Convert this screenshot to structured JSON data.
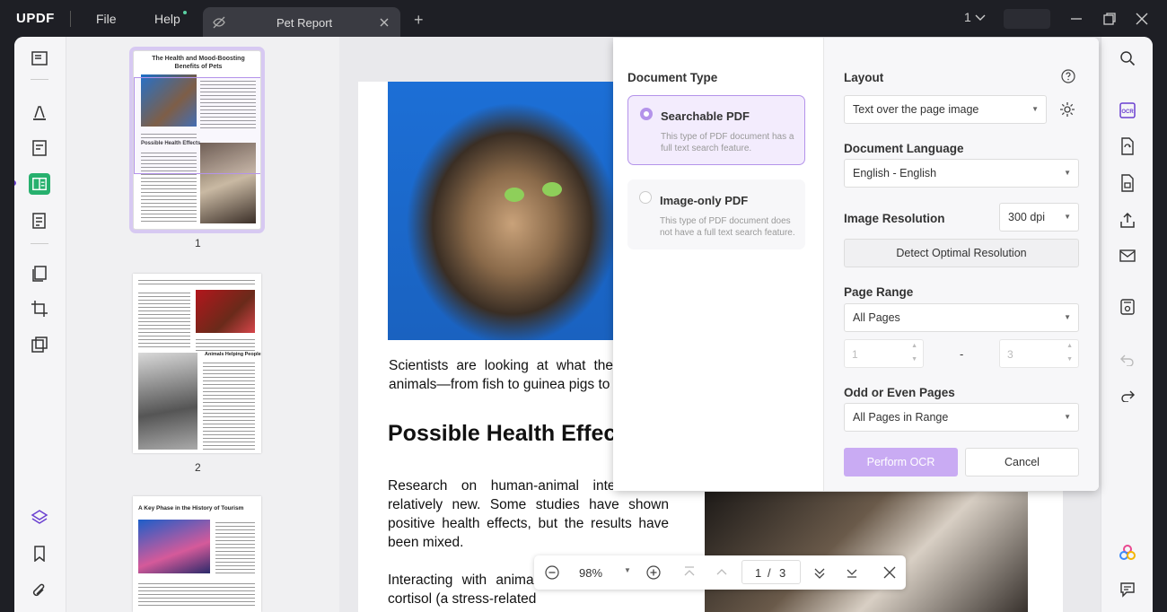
{
  "titlebar": {
    "logo": "UPDF",
    "menu_file": "File",
    "menu_help": "Help",
    "tab_title": "Pet Report",
    "page_indicator": "1"
  },
  "thumbnails": {
    "page1": {
      "number": "1",
      "title": "The Health and Mood-Boosting Benefits of Pets",
      "heading": "Possible Health Effects"
    },
    "page2": {
      "number": "2",
      "heading": "Animals Helping People"
    },
    "page3": {
      "title": "A Key Phase in the History of Tourism"
    }
  },
  "document": {
    "para1": "Scientists are looking at what the animals—from fish to guinea pigs to",
    "heading": "Possible Health Effec",
    "para2": "Research on human-animal interac still relatively new. Some studies have shown positive health effects, but the results have been mixed.",
    "para3": "Interacting with animal decrease levels of cortisol (a stress-related"
  },
  "ocr": {
    "document_type_label": "Document Type",
    "searchable_title": "Searchable PDF",
    "searchable_desc": "This type of PDF document has a full text search feature.",
    "imageonly_title": "Image-only PDF",
    "imageonly_desc": "This type of PDF document does not have a full text search feature.",
    "layout_label": "Layout",
    "layout_value": "Text over the page image",
    "language_label": "Document Language",
    "language_value": "English - English",
    "resolution_label": "Image Resolution",
    "resolution_value": "300 dpi",
    "detect_button": "Detect Optimal Resolution",
    "range_label": "Page Range",
    "range_value": "All Pages",
    "range_from": "1",
    "range_dash": "-",
    "range_to": "3",
    "odd_even_label": "Odd or Even Pages",
    "odd_even_value": "All Pages in Range",
    "perform_button": "Perform OCR",
    "cancel_button": "Cancel"
  },
  "zoom": {
    "level": "98%",
    "current_page": "1",
    "separator": "/",
    "total_pages": "3"
  },
  "colors": {
    "accent_purple": "#b493ea",
    "active_green": "#27b06e",
    "titlebar_bg": "#1e1f25"
  }
}
